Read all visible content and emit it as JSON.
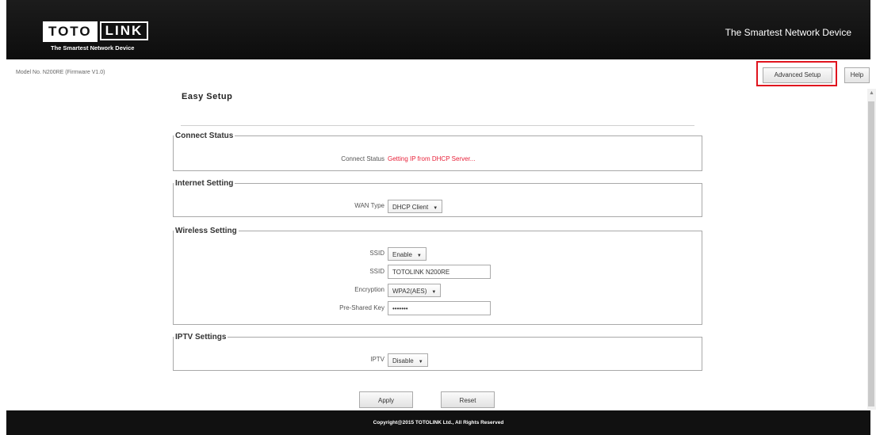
{
  "header": {
    "logo_part1": "TOTO",
    "logo_part2": "LINK",
    "logo_sub": "The Smartest Network Device",
    "tagline": "The Smartest Network Device"
  },
  "topbar": {
    "model_info": "Model No. N200RE (Firmware V1.0)",
    "advanced_setup_label": "Advanced Setup",
    "help_label": "Help"
  },
  "page": {
    "title": "Easy Setup"
  },
  "connect_status": {
    "legend": "Connect Status",
    "label": "Connect Status",
    "value": "Getting IP from DHCP Server..."
  },
  "internet_setting": {
    "legend": "Internet Setting",
    "wan_type_label": "WAN Type",
    "wan_type_value": "DHCP Client"
  },
  "wireless_setting": {
    "legend": "Wireless Setting",
    "ssid_state_label": "SSID",
    "ssid_state_value": "Enable",
    "ssid_label": "SSID",
    "ssid_value": "TOTOLINK N200RE",
    "encryption_label": "Encryption",
    "encryption_value": "WPA2(AES)",
    "psk_label": "Pre-Shared Key",
    "psk_value": "•••••••"
  },
  "iptv_settings": {
    "legend": "IPTV Settings",
    "iptv_label": "IPTV",
    "iptv_value": "Disable"
  },
  "actions": {
    "apply_label": "Apply",
    "reset_label": "Reset"
  },
  "footer": {
    "copyright": "Copyright@2015 TOTOLINK Ltd., All Rights Reserved"
  },
  "colors": {
    "highlight": "#e0141e",
    "status_text": "#e8223a",
    "header_bg": "#111111"
  }
}
